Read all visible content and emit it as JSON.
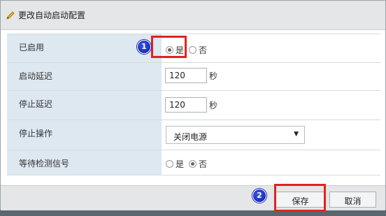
{
  "dialog": {
    "title": "更改自动启动配置",
    "icon": "pencil-icon"
  },
  "form": {
    "enabled": {
      "label": "已启用",
      "yes": "是",
      "no": "否",
      "selected": "yes"
    },
    "start_delay": {
      "label": "启动延迟",
      "value": "120",
      "unit": "秒"
    },
    "stop_delay": {
      "label": "停止延迟",
      "value": "120",
      "unit": "秒"
    },
    "stop_action": {
      "label": "停止操作",
      "value": "关闭电源"
    },
    "wait_heartbeat": {
      "label": "等待检测信号",
      "yes": "是",
      "no": "否",
      "selected": "no"
    }
  },
  "footer": {
    "save_label": "保存",
    "cancel_label": "取消"
  },
  "markers": {
    "m1": "1",
    "m2": "2"
  },
  "colors": {
    "highlight": "#e12222",
    "marker": "#1a2fc0",
    "label_bg": "#dde8f0"
  }
}
